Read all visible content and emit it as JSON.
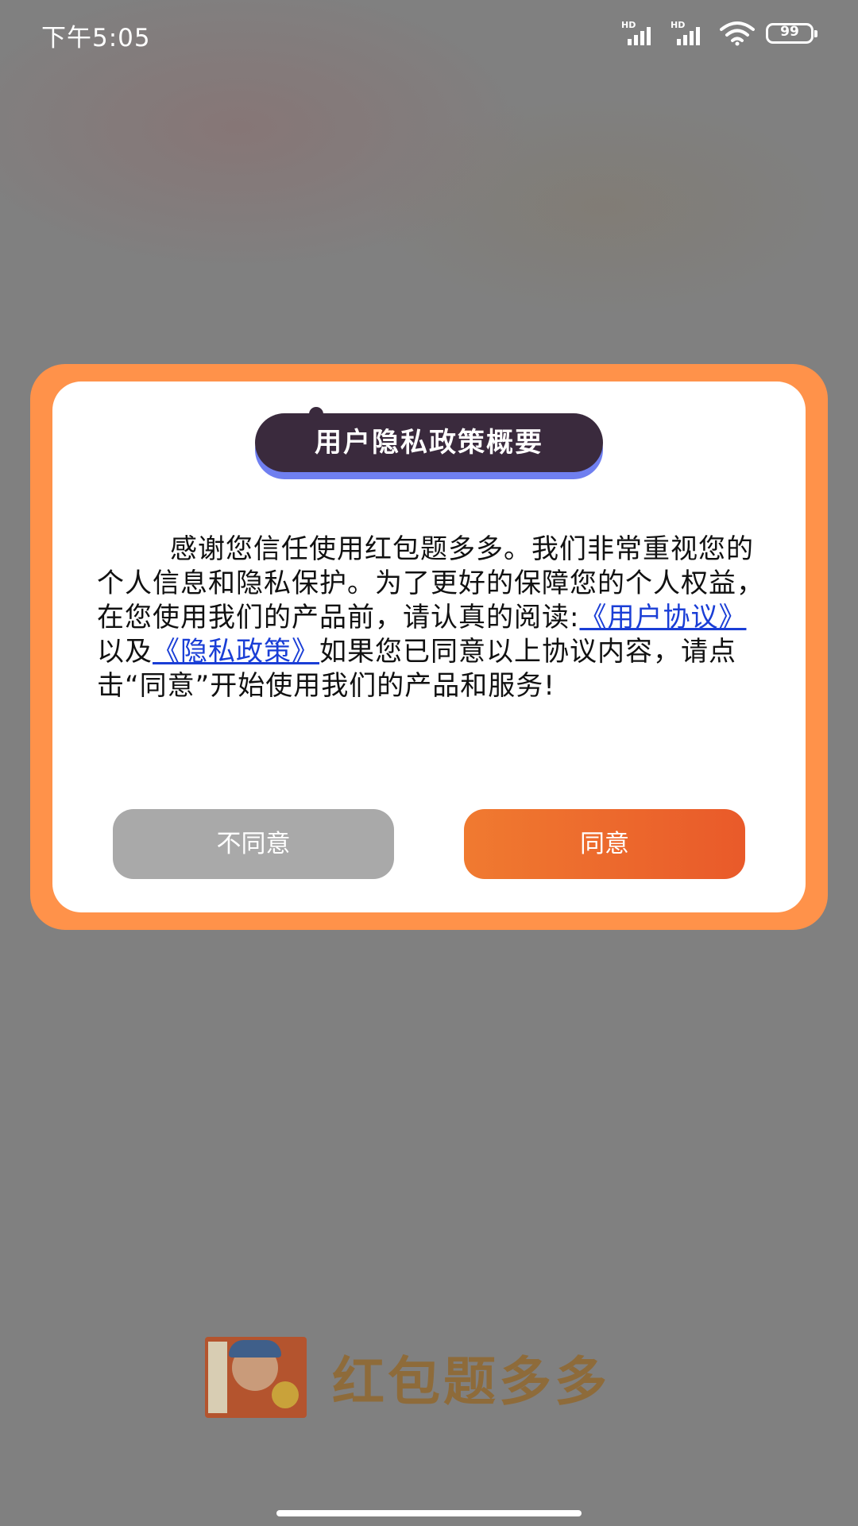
{
  "status_bar": {
    "time": "下午5:05",
    "signal_label_1": "HD",
    "signal_label_2": "HD",
    "battery_level": "99"
  },
  "dialog": {
    "title": "用户隐私政策概要",
    "text_1": "感谢您信任使用红包题多多。我们非常重视您的个人信息和隐私保护。为了更好的保障您的个人权益，在您使用我们的产品前，请认真的阅读:",
    "link_user_agreement": "《用户协议》",
    "text_2": "以及",
    "link_privacy_policy": "《隐私政策》",
    "text_3": "如果您已同意以上协议内容，请点击“同意”开始使用我们的产品和服务!",
    "disagree_label": "不同意",
    "agree_label": "同意"
  },
  "brand": {
    "name": "红包题多多"
  },
  "colors": {
    "dialog_frame": "#ff924a",
    "agree_button": "#ec6a2d",
    "disagree_button": "#a9a9a9",
    "link": "#1a3ed6",
    "title_pill": "#3a2a3d",
    "title_shadow": "#6f7ff0"
  },
  "icons": [
    "signal-icon",
    "signal-icon",
    "wifi-icon",
    "battery-icon",
    "app-logo-icon",
    "home-indicator"
  ]
}
